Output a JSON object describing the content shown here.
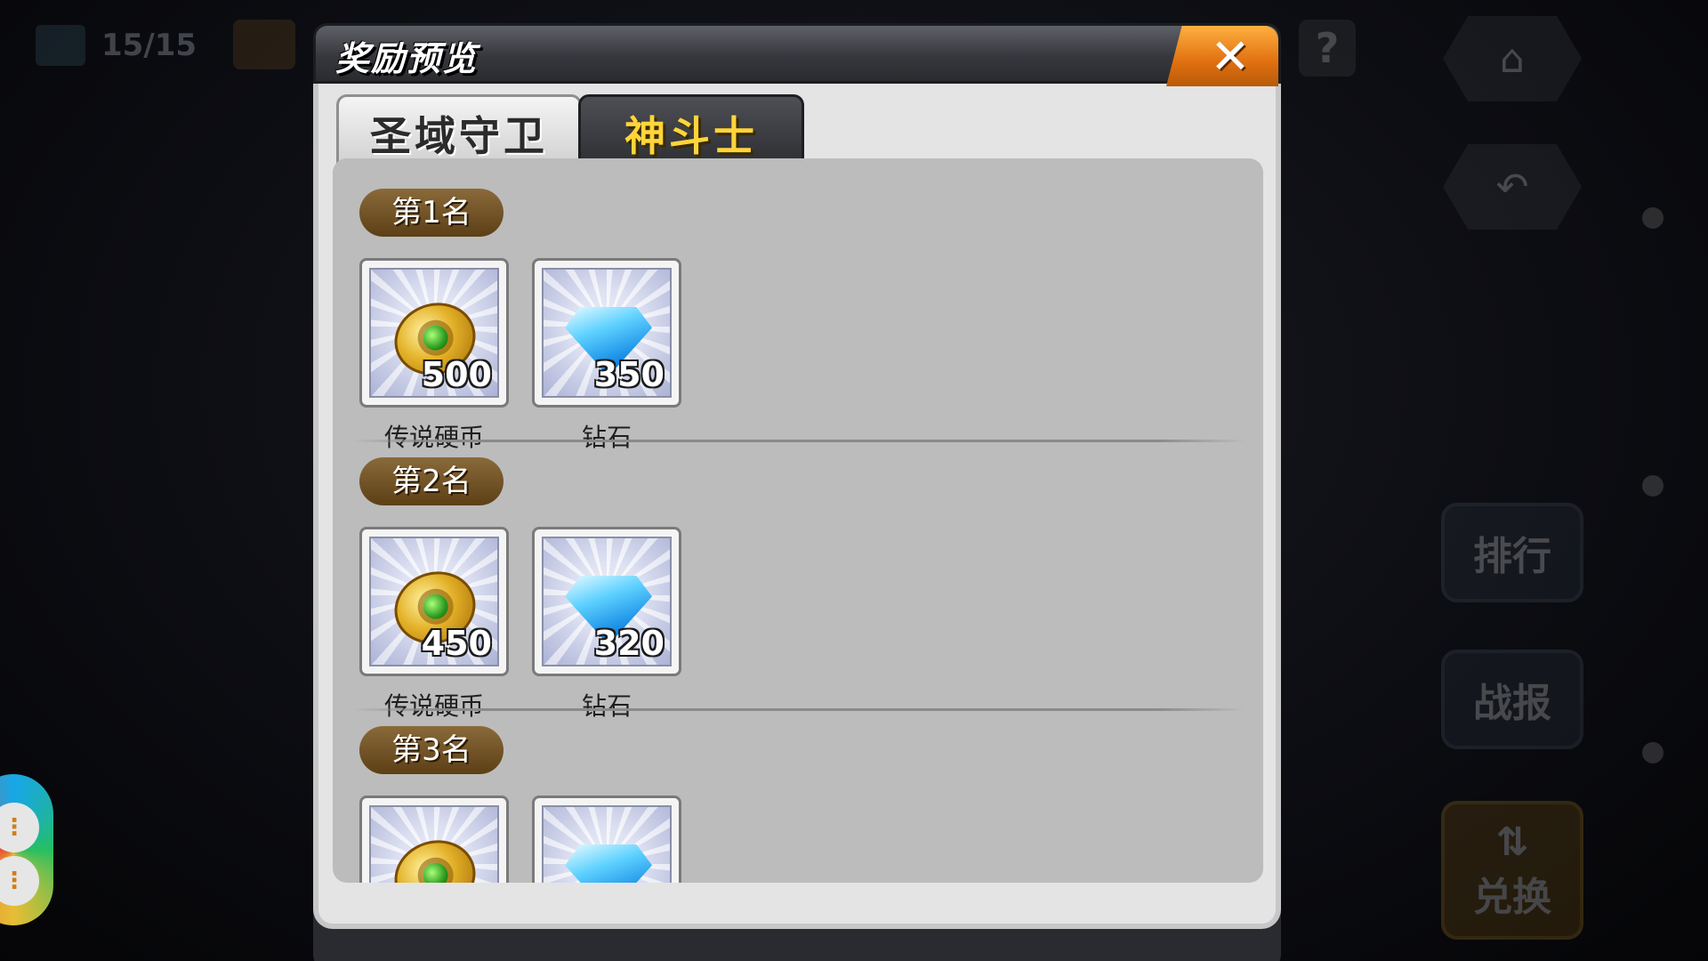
{
  "hud": {
    "counter_text": "15/15",
    "help_glyph": "?",
    "side_buttons": {
      "rank": "排行",
      "report": "战报",
      "exchange_arrows": "⇅",
      "exchange": "兑换"
    }
  },
  "dialog": {
    "title": "奖励预览",
    "close_glyph": "✕",
    "tabs": [
      {
        "label": "圣域守卫",
        "selected": false
      },
      {
        "label": "神斗士",
        "selected": true
      }
    ],
    "ranks": [
      {
        "label": "第1名",
        "rewards": [
          {
            "icon": "legend-coin-icon",
            "name": "传说硬币",
            "qty": "500"
          },
          {
            "icon": "diamond-icon",
            "name": "钻石",
            "qty": "350"
          }
        ]
      },
      {
        "label": "第2名",
        "rewards": [
          {
            "icon": "legend-coin-icon",
            "name": "传说硬币",
            "qty": "450"
          },
          {
            "icon": "diamond-icon",
            "name": "钻石",
            "qty": "320"
          }
        ]
      },
      {
        "label": "第3名",
        "rewards": [
          {
            "icon": "legend-coin-icon"
          },
          {
            "icon": "diamond-icon"
          }
        ]
      }
    ]
  },
  "colors": {
    "close_button": "#e07010",
    "selected_tab_text": "#ffd53a",
    "rank_badge": "#6e4f22"
  }
}
